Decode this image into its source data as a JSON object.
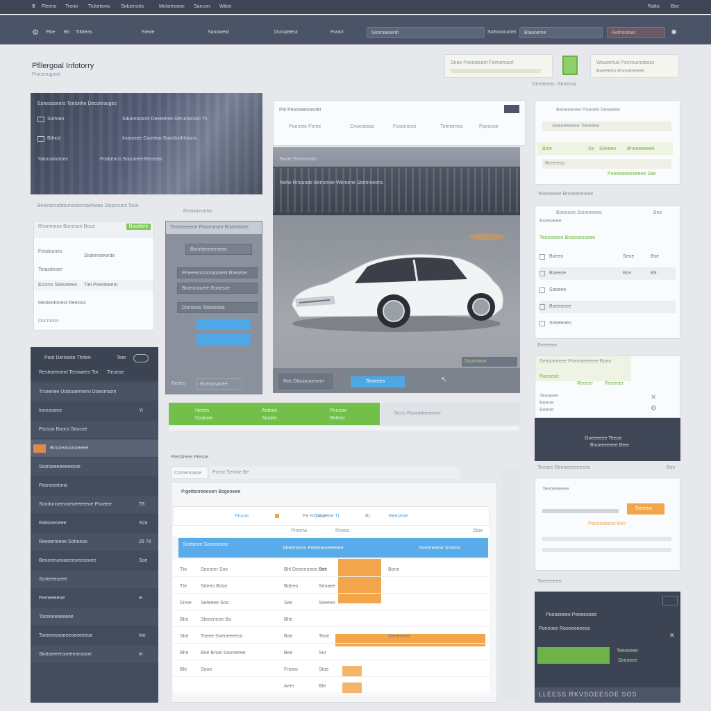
{
  "menubar": {
    "items": [
      "Ⅲ",
      "Fleeno",
      "Trorio",
      "Ticketions",
      "Siduervots",
      "Mclortroone",
      "Sancon",
      "Wiloe"
    ],
    "right": [
      "Ratto",
      "Bce"
    ]
  },
  "toolbar": {
    "items": [
      "Pliie",
      "Bn",
      "Tiltiteas",
      "Fiewe",
      "Sanoweid",
      "Dumpeleut",
      "Fivact",
      "Sonmawerdt",
      "Sulhonoumet",
      "Blaoneme",
      "Rethssitoin"
    ]
  },
  "page": {
    "title": "Pfllergoal Infotorry",
    "subtitle": "Pnessrugooh"
  },
  "top_badges": {
    "a": "Snoe Poxeuleant Fiomehourt",
    "b": "Wsuoehue Pecvounoteoss",
    "c": "Boeeenn Rooveneees",
    "d": "Gerotenns ·Sbnessa"
  },
  "hero": {
    "line1": "Eonessseers Teelonhe Decoersuges",
    "line2": "Sortoeo",
    "line2b": "Sdunroconnt Deveshoe Derumonocr Ts",
    "line3": "Bthicd",
    "line3b": "Inocosee Conetuo Soonbsthhouns",
    "line4": "Yalousdutrnec",
    "line4b": "Fosbenco Socuneel Recessc",
    "caption1": "Bnelrancobtouneolennaehwae Sleoccuns Toun",
    "caption2": "Rnetwrevehe"
  },
  "left_card": {
    "header": "Rhorimnee Bonesee Bouo",
    "header_right": "Bocelent",
    "r1": "Fetalounes",
    "r2": "Tetasdeoer",
    "r3": "Slidemeewrde",
    "r4": "Heoteofonest Reeioss",
    "r5": "Ecoms Skeuetees",
    "r6": "Tiel Pleedeeent",
    "r7": "Docmoos"
  },
  "mid_card": {
    "header": "Teeweeeeoe Ploomesee Bndereoee",
    "i1": "Boonleeeeeneen",
    "i2": "Pineeeuocontatooest Breseoe",
    "i3": "Bineonouete Rooesoe",
    "i4": "Dlemeoe Tolosedoe",
    "btn1": "",
    "btn2": "",
    "foot_left": "Beneo",
    "foot_box": "Rneousanee"
  },
  "main_image": {
    "title": "Pst Pesmoelmesfet",
    "close": "",
    "tabs": [
      "Poonete Pome",
      "Cnoestieas",
      "Fosorioeot",
      "Totmemeo",
      "Ppeocoe"
    ],
    "overlay1": "Bwde  Bneoensth",
    "overlay2": "Nehe Rnounde Bemonoe Weroerie Stotmoeons",
    "bottom_left": "Rek Dlouonoemrer",
    "bottom_btn": "Seveees",
    "foot_small": "Scuoneon"
  },
  "green_bar": {
    "cells": [
      [
        "Heees",
        "Doanwe"
      ],
      [
        "Aeteeo",
        "Sinoeo"
      ],
      [
        "Peeeoe",
        "Beteso"
      ]
    ],
    "tail": "Sicco Ronowloeeoner"
  },
  "left_dark": {
    "header": "Poot Derrieste Thrbm",
    "header_right": "Teer",
    "sub": "Reshoeenent Tesswees Tor",
    "sub_right": "Tinseoe",
    "items": [
      {
        "label": "Trceenee Uostuoemeno Doeorrasm",
        "value": ""
      },
      {
        "label": "Ineeooeee",
        "value": "Yi"
      },
      {
        "label": "Pscsso Boocs Sirocoe",
        "value": ""
      },
      {
        "label": "Bnooeanonoeeee",
        "value": "",
        "accent": true
      },
      {
        "label": "Sssroeeeeeeeesse",
        "value": ""
      },
      {
        "label": "Pitoneeetone",
        "value": ""
      },
      {
        "label": "Soodonoeeooeoeeeeeoe Pooeee",
        "value": "T8"
      },
      {
        "label": "Raboseoeee",
        "value": "S2a"
      },
      {
        "label": "Reeoeneeoe Soheeos",
        "value": "26 78"
      },
      {
        "label": "Beoeeeueoaeeeneeoooee",
        "value": "Soe"
      },
      {
        "label": "Sosteeeseee",
        "value": ""
      },
      {
        "label": "Pieneeeeoe",
        "value": "ei"
      },
      {
        "label": "Toceoeeeeeeoe",
        "value": ""
      },
      {
        "label": "Toeeeeoooeeeoeeeeeoe",
        "value": "Iee"
      },
      {
        "label": "Skoloieeerooeeeoeoooe",
        "value": "te"
      }
    ]
  },
  "table": {
    "section_title": "Pleottieee Piesoe",
    "tab_label": "Comemtaise",
    "tab2": "Pceot Sehtoe Be",
    "title": "Pigetteoreeeoen Bogeoeee",
    "filters": [
      "Pnoue",
      "Pe Rioatoe",
      "Taseeee Tt",
      "Bt",
      "Beeseoe"
    ],
    "col_heads": [
      "Pmonw",
      "Rnees",
      "Stoe"
    ],
    "selected": [
      "Srotbeee Soeeoeeee",
      "Sbeeroeoo Pdeeoeoeeeeee",
      "Sooeneene Soetoe"
    ],
    "rows": [
      {
        "a": "Tte",
        "b": "Seeorer Soe",
        "c": "Bhl Deeeeeeee Rvt",
        "d": "Bee",
        "e": "Bone"
      },
      {
        "a": "Tte",
        "b": "Sdeeo Bdse",
        "c": "Bdeeo",
        "d": "Seoaee",
        "e": ""
      },
      {
        "a": "Diroe",
        "b": "Seteeee Soo",
        "c": "Seo",
        "d": "Sseeeo",
        "e": ""
      },
      {
        "a": "Bhe",
        "b": "Sleeeneee Bo",
        "c": "Bhe",
        "d": "",
        "e": ""
      },
      {
        "a": "Sbe",
        "b": "Toeee Soeneeeeon",
        "c": "Bae",
        "d": "Teoe",
        "e": "Seeeoeoe"
      },
      {
        "a": "Bhe",
        "b": "Boe Bnoe Sooneeee",
        "c": "Bee",
        "d": "Sor",
        "e": ""
      },
      {
        "a": "Ble",
        "b": "Sooe",
        "c": "Fnoeo",
        "d": "Stoe",
        "e": ""
      },
      {
        "a": "",
        "b": "",
        "c": "Aeer",
        "d": "Bte",
        "e": ""
      }
    ]
  },
  "right_col": {
    "c1_title": "Beoeoenee Poeoee Deseeee",
    "c1_row": "Seeoeeeeee Teneeeo",
    "c1_green": [
      "Bloe",
      "Se",
      "Sneeee",
      "Bneeeeeeee"
    ],
    "c1_foot": "Reeeeoo",
    "c1_link": "Peeeoeeeeeeeee Sae",
    "c2_title": "Teoeoeeee Bnoeoeeoeee",
    "c2_head": "Boeeoee Soneeeeeo",
    "c2_head_right": "Bee",
    "c2_sub": "Bseeoeee",
    "c2_rows": [
      [
        "Boeeo",
        "Seoe",
        "Bse"
      ],
      [
        "Boeeoe",
        "Bce",
        "B9"
      ],
      [
        "Soeeeo",
        "",
        ""
      ],
      [
        "Boeeoeee",
        "",
        ""
      ],
      [
        "Sneeeoeo",
        "",
        ""
      ]
    ],
    "c2_foot": "Teoe",
    "c2_foot_label": "Beeeeee",
    "c3_title": "Sehsoeeeee Poeooeeeeee Boeo",
    "c3_green": [
      "Raceeoe",
      "Reeeer",
      "Reeeeer"
    ],
    "c3_rows": [
      "Teooeee",
      "Beeoe",
      "Boeoe"
    ],
    "c4_title": "Goeeeeee Teeoe",
    "c4_sub": "Bnoeeeeeee Beer",
    "c5_head": "Teeoee Beeoeeeeeeeoe",
    "c5_head_right": "Bee",
    "c5_title": "Teeoeeeeee",
    "c5_btn": "Seeeeo",
    "c5_link": "Peeoeeeeoe Beo",
    "c5_foot": "Toeeeeeeo",
    "c6_title": "Poooeeeeo Peeeeooee",
    "c6_sub": "Poeeoee Rooeeooeeoe",
    "c6_green": "Teeoeeee",
    "c6_green2": "Seeoeee",
    "c6_foot": "LLEESS RKVSOEESOE SOS"
  },
  "colors": {
    "accent_green": "#72c04a",
    "accent_orange": "#f2a54a",
    "accent_blue": "#4ea8e8",
    "dark_panel": "#434c5d",
    "toolbar": "#4b5466"
  }
}
